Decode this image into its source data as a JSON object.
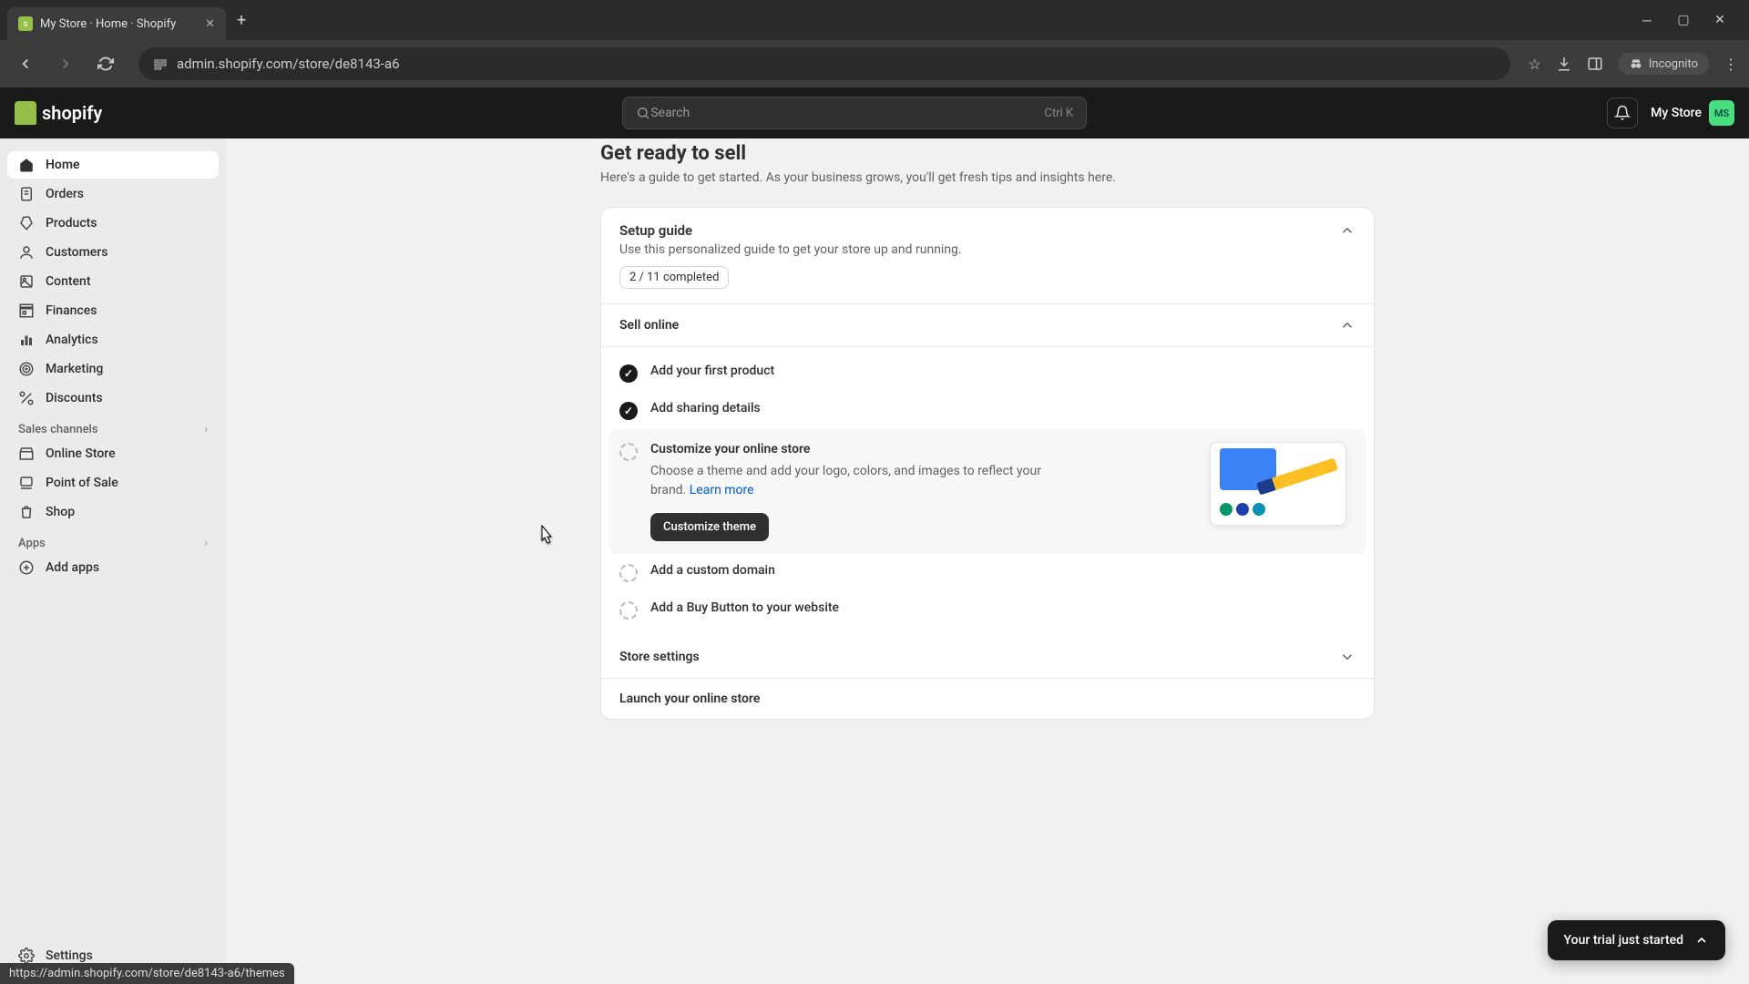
{
  "browser": {
    "tab_title": "My Store · Home · Shopify",
    "url": "admin.shopify.com/store/de8143-a6",
    "incognito_label": "Incognito",
    "status_url": "https://admin.shopify.com/store/de8143-a6/themes"
  },
  "header": {
    "logo_text": "shopify",
    "search_placeholder": "Search",
    "search_kbd": "Ctrl K",
    "store_name": "My Store",
    "store_initials": "MS"
  },
  "sidebar": {
    "nav": [
      {
        "label": "Home"
      },
      {
        "label": "Orders"
      },
      {
        "label": "Products"
      },
      {
        "label": "Customers"
      },
      {
        "label": "Content"
      },
      {
        "label": "Finances"
      },
      {
        "label": "Analytics"
      },
      {
        "label": "Marketing"
      },
      {
        "label": "Discounts"
      }
    ],
    "channels_label": "Sales channels",
    "channels": [
      {
        "label": "Online Store"
      },
      {
        "label": "Point of Sale"
      },
      {
        "label": "Shop"
      }
    ],
    "apps_label": "Apps",
    "add_apps": "Add apps",
    "settings": "Settings"
  },
  "page": {
    "title": "Get ready to sell",
    "subtitle": "Here's a guide to get started. As your business grows, you'll get fresh tips and insights here."
  },
  "setup": {
    "title": "Setup guide",
    "subtitle": "Use this personalized guide to get your store up and running.",
    "progress": "2 / 11 completed",
    "sections": {
      "sell": {
        "title": "Sell online",
        "tasks": [
          {
            "title": "Add your first product",
            "done": true
          },
          {
            "title": "Add sharing details",
            "done": true
          },
          {
            "title": "Customize your online store",
            "done": false,
            "desc": "Choose a theme and add your logo, colors, and images to reflect your brand. ",
            "learn_more": "Learn more",
            "button": "Customize theme"
          },
          {
            "title": "Add a custom domain",
            "done": false
          },
          {
            "title": "Add a Buy Button to your website",
            "done": false
          }
        ]
      },
      "store_settings": {
        "title": "Store settings"
      },
      "launch": {
        "title": "Launch your online store"
      }
    }
  },
  "toast": {
    "text": "Your trial just started"
  }
}
